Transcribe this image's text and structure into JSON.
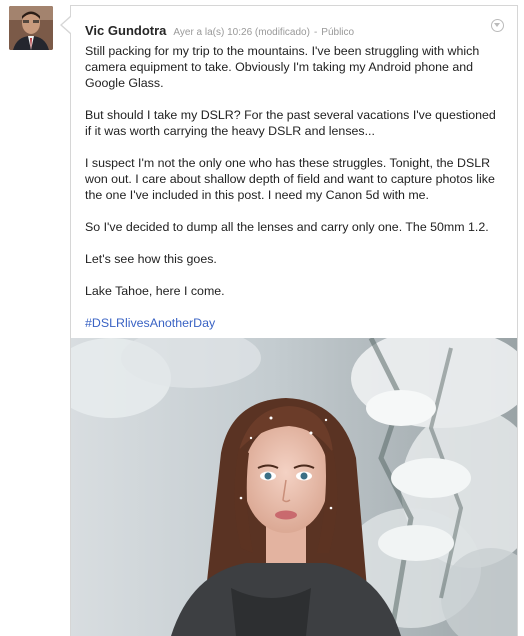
{
  "post": {
    "author": "Vic Gundotra",
    "timestamp": "Ayer a la(s) 10:26 (modificado)",
    "separator": "-",
    "visibility": "Público",
    "paragraphs": [
      "Still packing for my trip to the mountains. I've been struggling with which camera equipment to take. Obviously I'm taking my Android phone and Google Glass.",
      "But should I take my DSLR? For the past several vacations I've questioned if it was worth carrying the heavy DSLR and lenses...",
      "I suspect I'm not the only one who has these struggles. Tonight, the DSLR won out. I care about shallow depth of field and want to capture photos like the one I've included in this post. I need my Canon 5d with me.",
      "So I've decided to dump all the lenses and carry only one. The 50mm 1.2.",
      "Let's see how this goes.",
      "Lake Tahoe, here I come."
    ],
    "hashtag": "#DSLRlivesAnotherDay"
  },
  "icons": {
    "avatar": "author-avatar",
    "menu": "chevron-down-icon",
    "photo": "attached-photo"
  }
}
